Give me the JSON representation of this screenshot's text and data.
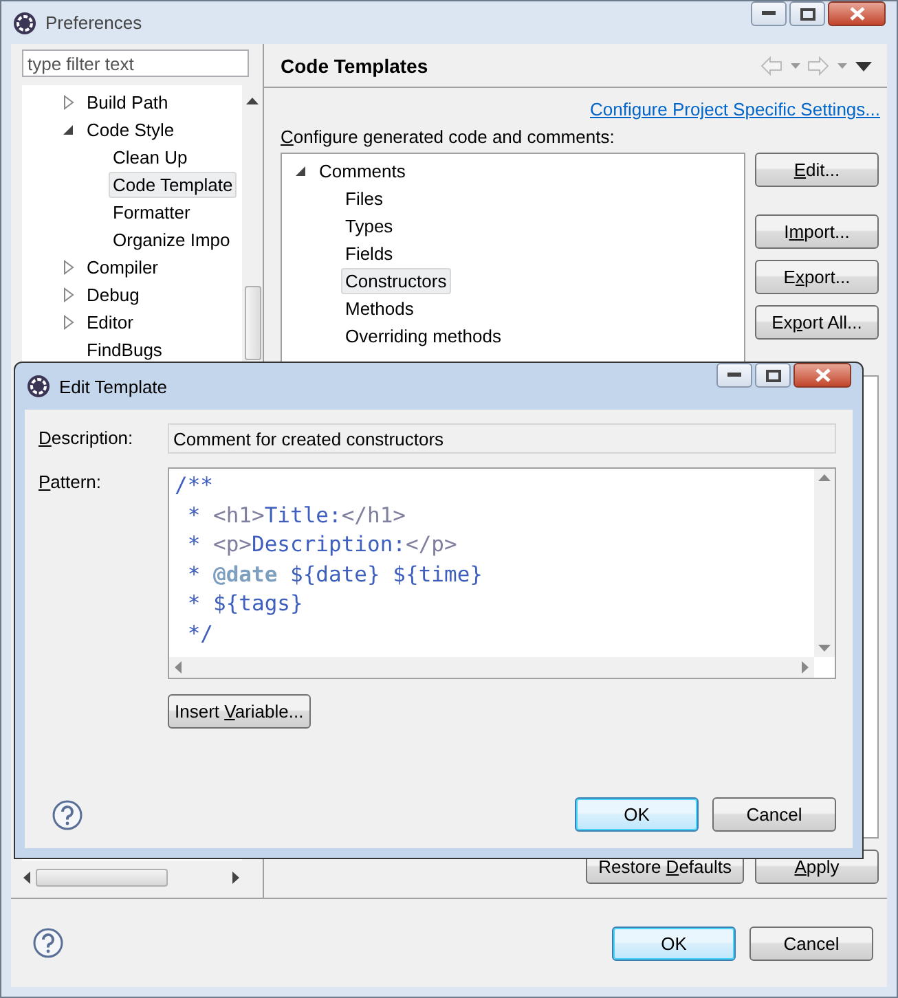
{
  "window": {
    "title": "Preferences"
  },
  "filter": {
    "placeholder": "type filter text"
  },
  "nav_tree": [
    {
      "label": "Build Path",
      "expanded": false,
      "selected": false
    },
    {
      "label": "Code Style",
      "expanded": true,
      "selected": false,
      "children": [
        {
          "label": "Clean Up",
          "selected": false
        },
        {
          "label": "Code Template",
          "selected": true
        },
        {
          "label": "Formatter",
          "selected": false
        },
        {
          "label": "Organize Impo",
          "selected": false
        }
      ]
    },
    {
      "label": "Compiler",
      "expanded": false,
      "selected": false
    },
    {
      "label": "Debug",
      "expanded": false,
      "selected": false
    },
    {
      "label": "Editor",
      "expanded": false,
      "selected": false
    },
    {
      "label": "FindBugs",
      "selected": false
    }
  ],
  "page": {
    "title": "Code Templates",
    "link": "Configure Project Specific Settings...",
    "tree_label": [
      {
        "text": "C",
        "underlined": true
      },
      {
        "text": "onfigure generated code and comments:",
        "underlined": false
      }
    ],
    "templates": [
      {
        "label": "Comments",
        "expanded": true,
        "selected": false,
        "children": [
          {
            "label": "Files",
            "selected": false
          },
          {
            "label": "Types",
            "selected": false
          },
          {
            "label": "Fields",
            "selected": false
          },
          {
            "label": "Constructors",
            "selected": true
          },
          {
            "label": "Methods",
            "selected": false
          },
          {
            "label": "Overriding methods",
            "selected": false
          }
        ]
      }
    ],
    "buttons": [
      {
        "label": [
          {
            "text": "E",
            "underlined": true
          },
          {
            "text": "dit...",
            "underlined": false
          }
        ]
      },
      {
        "label": [
          {
            "text": "I",
            "underlined": false
          },
          {
            "text": "m",
            "underlined": true
          },
          {
            "text": "port...",
            "underlined": false
          }
        ]
      },
      {
        "label": [
          {
            "text": "E",
            "underlined": false
          },
          {
            "text": "x",
            "underlined": true
          },
          {
            "text": "port...",
            "underlined": false
          }
        ]
      },
      {
        "label": [
          {
            "text": "Ex",
            "underlined": false
          },
          {
            "text": "p",
            "underlined": true
          },
          {
            "text": "ort All...",
            "underlined": false
          }
        ]
      }
    ],
    "footer_buttons": [
      {
        "label": [
          {
            "text": "Restore ",
            "underlined": false
          },
          {
            "text": "D",
            "underlined": true
          },
          {
            "text": "efaults",
            "underlined": false
          }
        ]
      },
      {
        "label": [
          {
            "text": "A",
            "underlined": true
          },
          {
            "text": "pply",
            "underlined": false
          }
        ]
      }
    ]
  },
  "buttons": [
    {
      "label": "OK",
      "default": true
    },
    {
      "label": "Cancel",
      "default": false
    }
  ],
  "dialog": {
    "title": "Edit Template",
    "description": {
      "label": [
        {
          "text": "D",
          "underlined": true
        },
        {
          "text": "escription:",
          "underlined": false
        }
      ],
      "value": "Comment for created constructors"
    },
    "pattern": {
      "label": [
        {
          "text": "P",
          "underlined": true
        },
        {
          "text": "attern:",
          "underlined": false
        }
      ],
      "lines": [
        [
          {
            "text": "/**",
            "kind": "comment"
          }
        ],
        [
          {
            "text": " * ",
            "kind": "comment"
          },
          {
            "text": "<h1>",
            "kind": "tag"
          },
          {
            "text": "Title:",
            "kind": "comment"
          },
          {
            "text": "</h1>",
            "kind": "tag"
          }
        ],
        [
          {
            "text": " * ",
            "kind": "comment"
          },
          {
            "text": "<p>",
            "kind": "tag"
          },
          {
            "text": "Description:",
            "kind": "comment"
          },
          {
            "text": "</p>",
            "kind": "tag"
          }
        ],
        [
          {
            "text": " * ",
            "kind": "comment"
          },
          {
            "text": "@date",
            "kind": "keyword"
          },
          {
            "text": " ${date} ${time}",
            "kind": "comment"
          }
        ],
        [
          {
            "text": " * ${tags}",
            "kind": "comment"
          }
        ],
        [
          {
            "text": " */",
            "kind": "comment"
          }
        ]
      ]
    },
    "insert_button": {
      "label": [
        {
          "text": "Insert ",
          "underlined": false
        },
        {
          "text": "V",
          "underlined": true
        },
        {
          "text": "ariable...",
          "underlined": false
        }
      ]
    },
    "buttons": [
      {
        "label": "OK",
        "default": true
      },
      {
        "label": "Cancel",
        "default": false
      }
    ]
  }
}
